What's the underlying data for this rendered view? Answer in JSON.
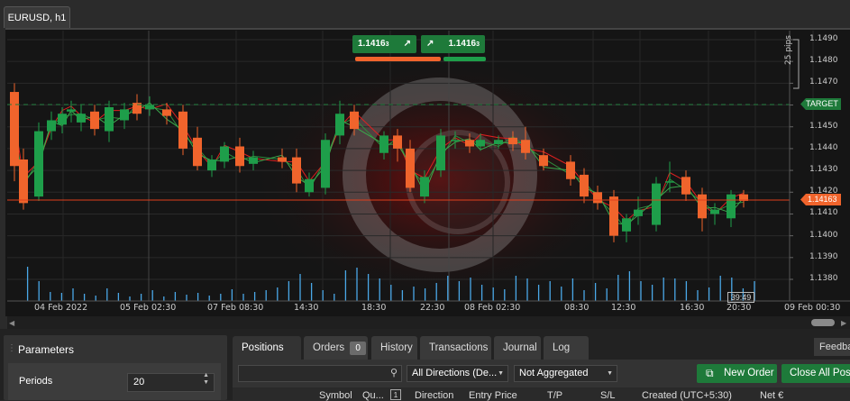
{
  "chart_tab": {
    "label": "EURUSD, h1"
  },
  "quote": {
    "sell": "1.1416",
    "sell_sup": "3",
    "buy": "1.1416",
    "buy_sup": "3"
  },
  "price_axis": [
    "1.1490",
    "1.1480",
    "1.1470",
    "1.1460",
    "1.1450",
    "1.1440",
    "1.1430",
    "1.1420",
    "1.1410",
    "1.1400",
    "1.1390",
    "1.1380"
  ],
  "target_label": "TARGET",
  "current_price_label": "1.14163",
  "pips_label": "25 pips",
  "time_axis": [
    "04 Feb 2022",
    "05 Feb 02:30",
    "07 Feb 08:30",
    "14:30",
    "18:30",
    "22:30",
    "08 Feb 02:30",
    "08:30",
    "12:30",
    "16:30",
    "20:30",
    "09 Feb 00:30"
  ],
  "countdown": "39:49",
  "colors": {
    "bull": "#1e9e4a",
    "bear": "#f0642c",
    "target_line": "#1e7a3a",
    "price_line": "#e0401c",
    "volume": "#4aa8e8"
  },
  "parameters": {
    "title": "Parameters",
    "periods_label": "Periods",
    "periods_value": "20"
  },
  "tabs": [
    {
      "label": "Positions",
      "count": "0"
    },
    {
      "label": "Orders",
      "count": "0"
    },
    {
      "label": "History"
    },
    {
      "label": "Transactions"
    },
    {
      "label": "Journal"
    },
    {
      "label": "Log"
    }
  ],
  "feedback_label": "Feedback",
  "filters": {
    "direction": "All Directions (De...",
    "aggregation": "Not Aggregated"
  },
  "buttons": {
    "new_order": "New Order",
    "close_all": "Close All Positions"
  },
  "table_headers": [
    "Symbol",
    "Qu...",
    "1",
    "Direction",
    "Entry Price",
    "T/P",
    "S/L",
    "Created (UTC+5:30)",
    "Net €"
  ]
}
